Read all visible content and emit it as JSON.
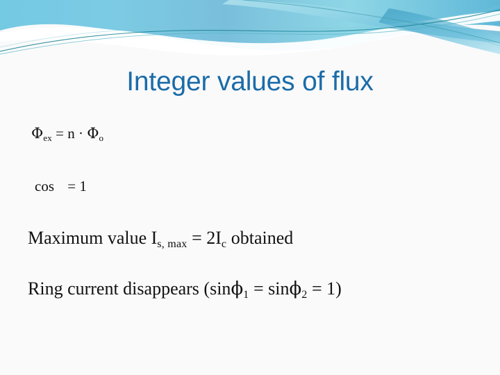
{
  "slide": {
    "title": "Integer values of flux",
    "title_color": "#1b6ca8",
    "background_color": "#fafafb",
    "body_text_color": "#111111"
  },
  "decoration": {
    "name": "flow-theme-header-wave",
    "colors": {
      "cyan_light": "#8fd9e8",
      "cyan_mid": "#74c9e3",
      "blue_mid": "#79bfdc",
      "blue_deep": "#4ea9cf",
      "teal_line": "#13818f",
      "teal_line_soft": "#4fb3c0",
      "white": "#ffffff"
    }
  },
  "body": {
    "lines": [
      {
        "id": "flux-quantization",
        "size": "small",
        "parts": [
          {
            "text": "Φ"
          },
          {
            "text": "ex",
            "sub": true
          },
          {
            "text": " = n · Φ"
          },
          {
            "text": "o",
            "sub": true
          }
        ],
        "plain": "Φex = n · Φo"
      },
      {
        "id": "cosine-condition",
        "size": "small",
        "parts": [
          {
            "text": "cos"
          },
          {
            "gap": true
          },
          {
            "text": " = 1"
          }
        ],
        "plain": "cos  = 1"
      },
      {
        "id": "maximum-value",
        "size": "large",
        "parts": [
          {
            "text": "Maximum value I"
          },
          {
            "text": "s, max",
            "sub": true
          },
          {
            "text": " = 2I"
          },
          {
            "text": "c",
            "sub": true
          },
          {
            "text": " obtained"
          }
        ],
        "plain": "Maximum value Is, max = 2Ic obtained"
      },
      {
        "id": "ring-current",
        "size": "large",
        "parts": [
          {
            "text": "Ring current disappears (sinϕ"
          },
          {
            "text": "1",
            "sub": true
          },
          {
            "text": " = sinϕ"
          },
          {
            "text": "2",
            "sub": true
          },
          {
            "text": " = 1)"
          }
        ],
        "plain": "Ring current disappears (sinϕ1 = sinϕ2 = 1)"
      }
    ]
  }
}
